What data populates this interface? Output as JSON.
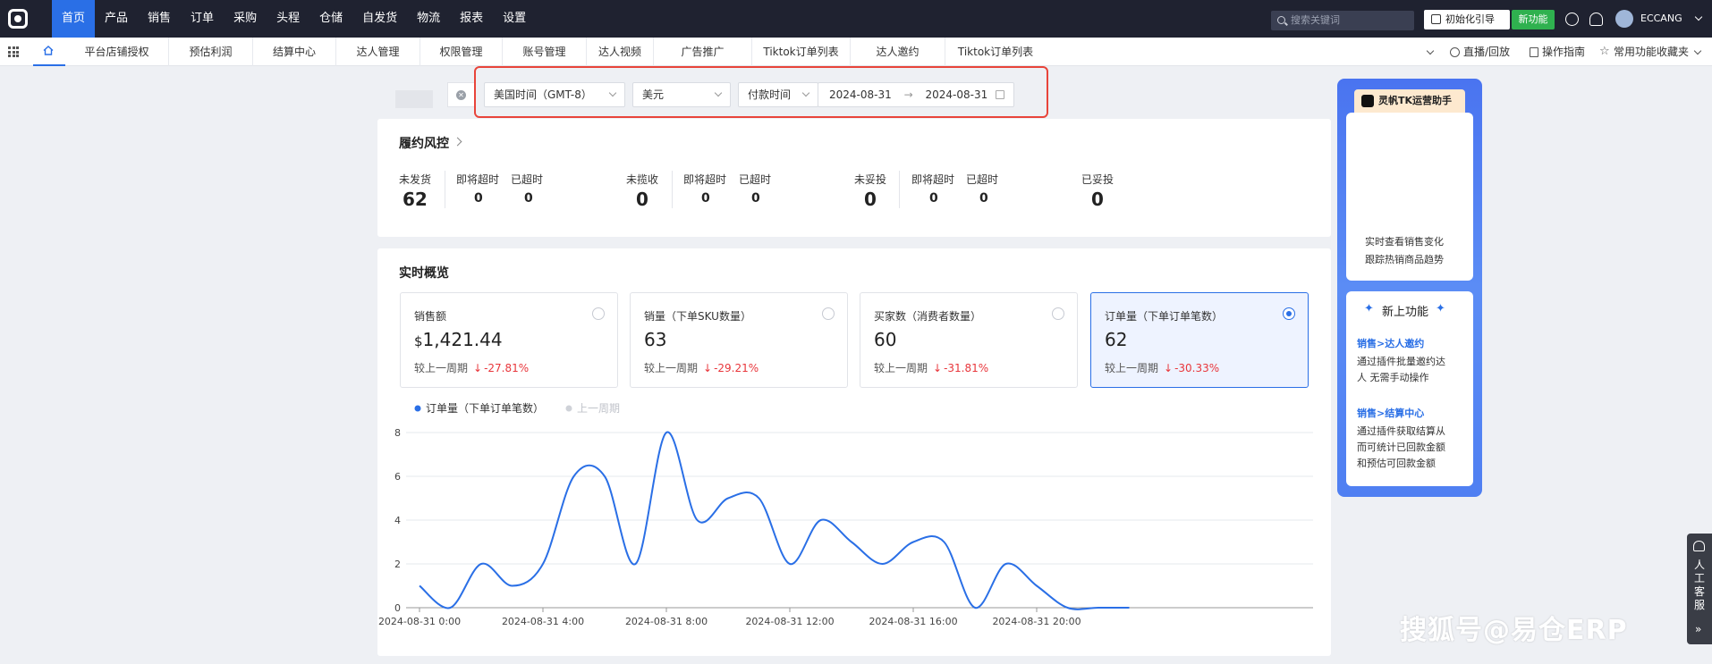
{
  "nav": {
    "items": [
      "首页",
      "产品",
      "销售",
      "订单",
      "采购",
      "头程",
      "仓储",
      "自发货",
      "物流",
      "报表",
      "设置"
    ],
    "search_placeholder": "搜索关键词",
    "init_guide": "初始化引导",
    "new_feature": "新功能",
    "username": "ECCANG"
  },
  "tabs": {
    "items": [
      "平台店铺授权",
      "预估利润",
      "结算中心",
      "达人管理",
      "权限管理",
      "账号管理",
      "达人视频",
      "广告推广",
      "Tiktok订单列表",
      "达人邀约",
      "Tiktok订单列表"
    ],
    "live": "直播/回放",
    "guide": "操作指南",
    "favorites": "常用功能收藏夹"
  },
  "filters": {
    "timezone": "美国时间（GMT-8）",
    "currency": "美元",
    "time_type": "付款时间",
    "date_start": "2024-08-31",
    "date_sep": "→",
    "date_end": "2024-08-31"
  },
  "fulfillment": {
    "title": "履约风控",
    "groups": [
      {
        "main_label": "未发货",
        "main_value": "62",
        "sub": [
          {
            "label": "即将超时",
            "value": "0"
          },
          {
            "label": "已超时",
            "value": "0"
          }
        ]
      },
      {
        "main_label": "未揽收",
        "main_value": "0",
        "sub": [
          {
            "label": "即将超时",
            "value": "0"
          },
          {
            "label": "已超时",
            "value": "0"
          }
        ]
      },
      {
        "main_label": "未妥投",
        "main_value": "0",
        "sub": [
          {
            "label": "即将超时",
            "value": "0"
          },
          {
            "label": "已超时",
            "value": "0"
          }
        ]
      },
      {
        "main_label": "已妥投",
        "main_value": "0",
        "sub": []
      }
    ]
  },
  "realtime": {
    "title": "实时概览",
    "compare_label": "较上一周期",
    "metrics": [
      {
        "title": "销售额",
        "currency": "$",
        "value": "1,421.44",
        "change": "-27.81%",
        "selected": false
      },
      {
        "title": "销量（下单SKU数量）",
        "currency": "",
        "value": "63",
        "change": "-29.21%",
        "selected": false
      },
      {
        "title": "买家数（消费者数量）",
        "currency": "",
        "value": "60",
        "change": "-31.81%",
        "selected": false
      },
      {
        "title": "订单量（下单订单笔数）",
        "currency": "",
        "value": "62",
        "change": "-30.33%",
        "selected": true
      }
    ]
  },
  "chart_data": {
    "type": "line",
    "legend": [
      "订单量（下单订单笔数）",
      "上一周期"
    ],
    "x": [
      "0:00",
      "1:00",
      "2:00",
      "3:00",
      "4:00",
      "5:00",
      "6:00",
      "7:00",
      "8:00",
      "9:00",
      "10:00",
      "11:00",
      "12:00",
      "13:00",
      "14:00",
      "15:00",
      "16:00",
      "17:00",
      "18:00",
      "19:00",
      "20:00",
      "21:00",
      "22:00",
      "23:00"
    ],
    "xticks": [
      "2024-08-31 0:00",
      "2024-08-31 4:00",
      "2024-08-31 8:00",
      "2024-08-31 12:00",
      "2024-08-31 16:00",
      "2024-08-31 20:00"
    ],
    "series": [
      {
        "name": "订单量（下单订单笔数）",
        "color": "#2a6fe6",
        "values": [
          1,
          0,
          2,
          1,
          2,
          6,
          6,
          2,
          8,
          4,
          5,
          5,
          2,
          4,
          3,
          2,
          3,
          3,
          0,
          2,
          1,
          0,
          0,
          0
        ]
      }
    ],
    "ylim": [
      0,
      8
    ],
    "yticks": [
      0,
      2,
      4,
      6,
      8
    ],
    "grid": true,
    "legend_position": "top-left"
  },
  "assistant": {
    "title": "灵帆TK运营助手",
    "desc1": "实时查看销售变化",
    "desc2": "跟踪热销商品趋势",
    "new_title": "新上功能",
    "feature1_link": "销售>达人邀约",
    "feature1_desc1": "通过插件批量邀约达",
    "feature1_desc2": "人 无需手动操作",
    "feature2_link": "销售>结算中心",
    "feature2_desc1": "通过插件获取结算从",
    "feature2_desc2": "而可统计已回款金额",
    "feature2_desc3": "和预估可回款金额"
  },
  "service": {
    "label": "人工客服"
  },
  "watermark": "搜狐号@易仓ERP"
}
